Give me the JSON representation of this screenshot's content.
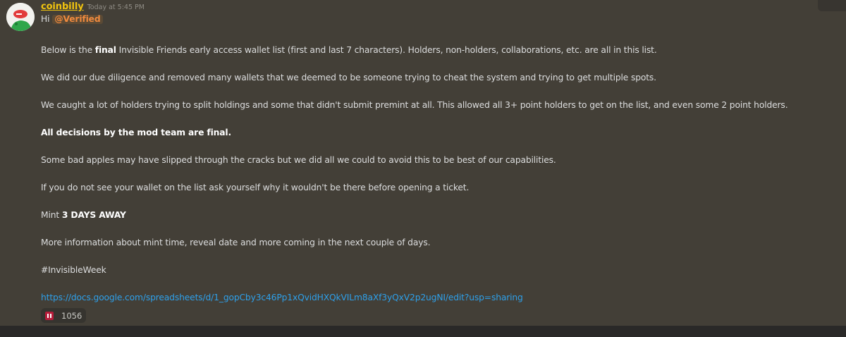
{
  "message": {
    "author": "coinbilly",
    "timestamp": "Today at 5:45 PM",
    "greeting": "Hi",
    "mention": "@Verified",
    "p1_before": "Below is the ",
    "p1_bold": "final",
    "p1_after": " Invisible Friends early access wallet list (first and last 7 characters). Holders, non-holders, collaborations, etc. are all in this list.",
    "p2": "We did our due diligence and removed many wallets that we deemed to be someone trying to cheat the system and trying to get multiple spots.",
    "p3": "We caught a lot of holders trying to split holdings and some that didn't submit premint at all. This allowed all 3+ point holders to get on the list, and even some 2 point holders.",
    "p4_bold": "All decisions by the mod team are final.",
    "p5": "Some bad apples may have slipped through the cracks but we did all we could to avoid this to be best of our capabilities.",
    "p6": "If you do not see your wallet on the list ask yourself why it wouldn't be there before opening a ticket.",
    "p7_before": "Mint ",
    "p7_bold": "3 DAYS AWAY",
    "p8": "More information about mint time, reveal date and more coming in the next couple of days.",
    "hashtag": "#InvisibleWeek",
    "link": "https://docs.google.com/spreadsheets/d/1_gopCby3c46Pp1xQvidHXQkVILm8aXf3yQxV2p2ugNI/edit?usp=sharing"
  },
  "reaction": {
    "emoji": "invisible-friends-emoji",
    "count": "1056"
  },
  "colors": {
    "background": "#433f37",
    "username": "#f1c40f",
    "mention": "#f08a3e",
    "link": "#2ea0ea"
  }
}
